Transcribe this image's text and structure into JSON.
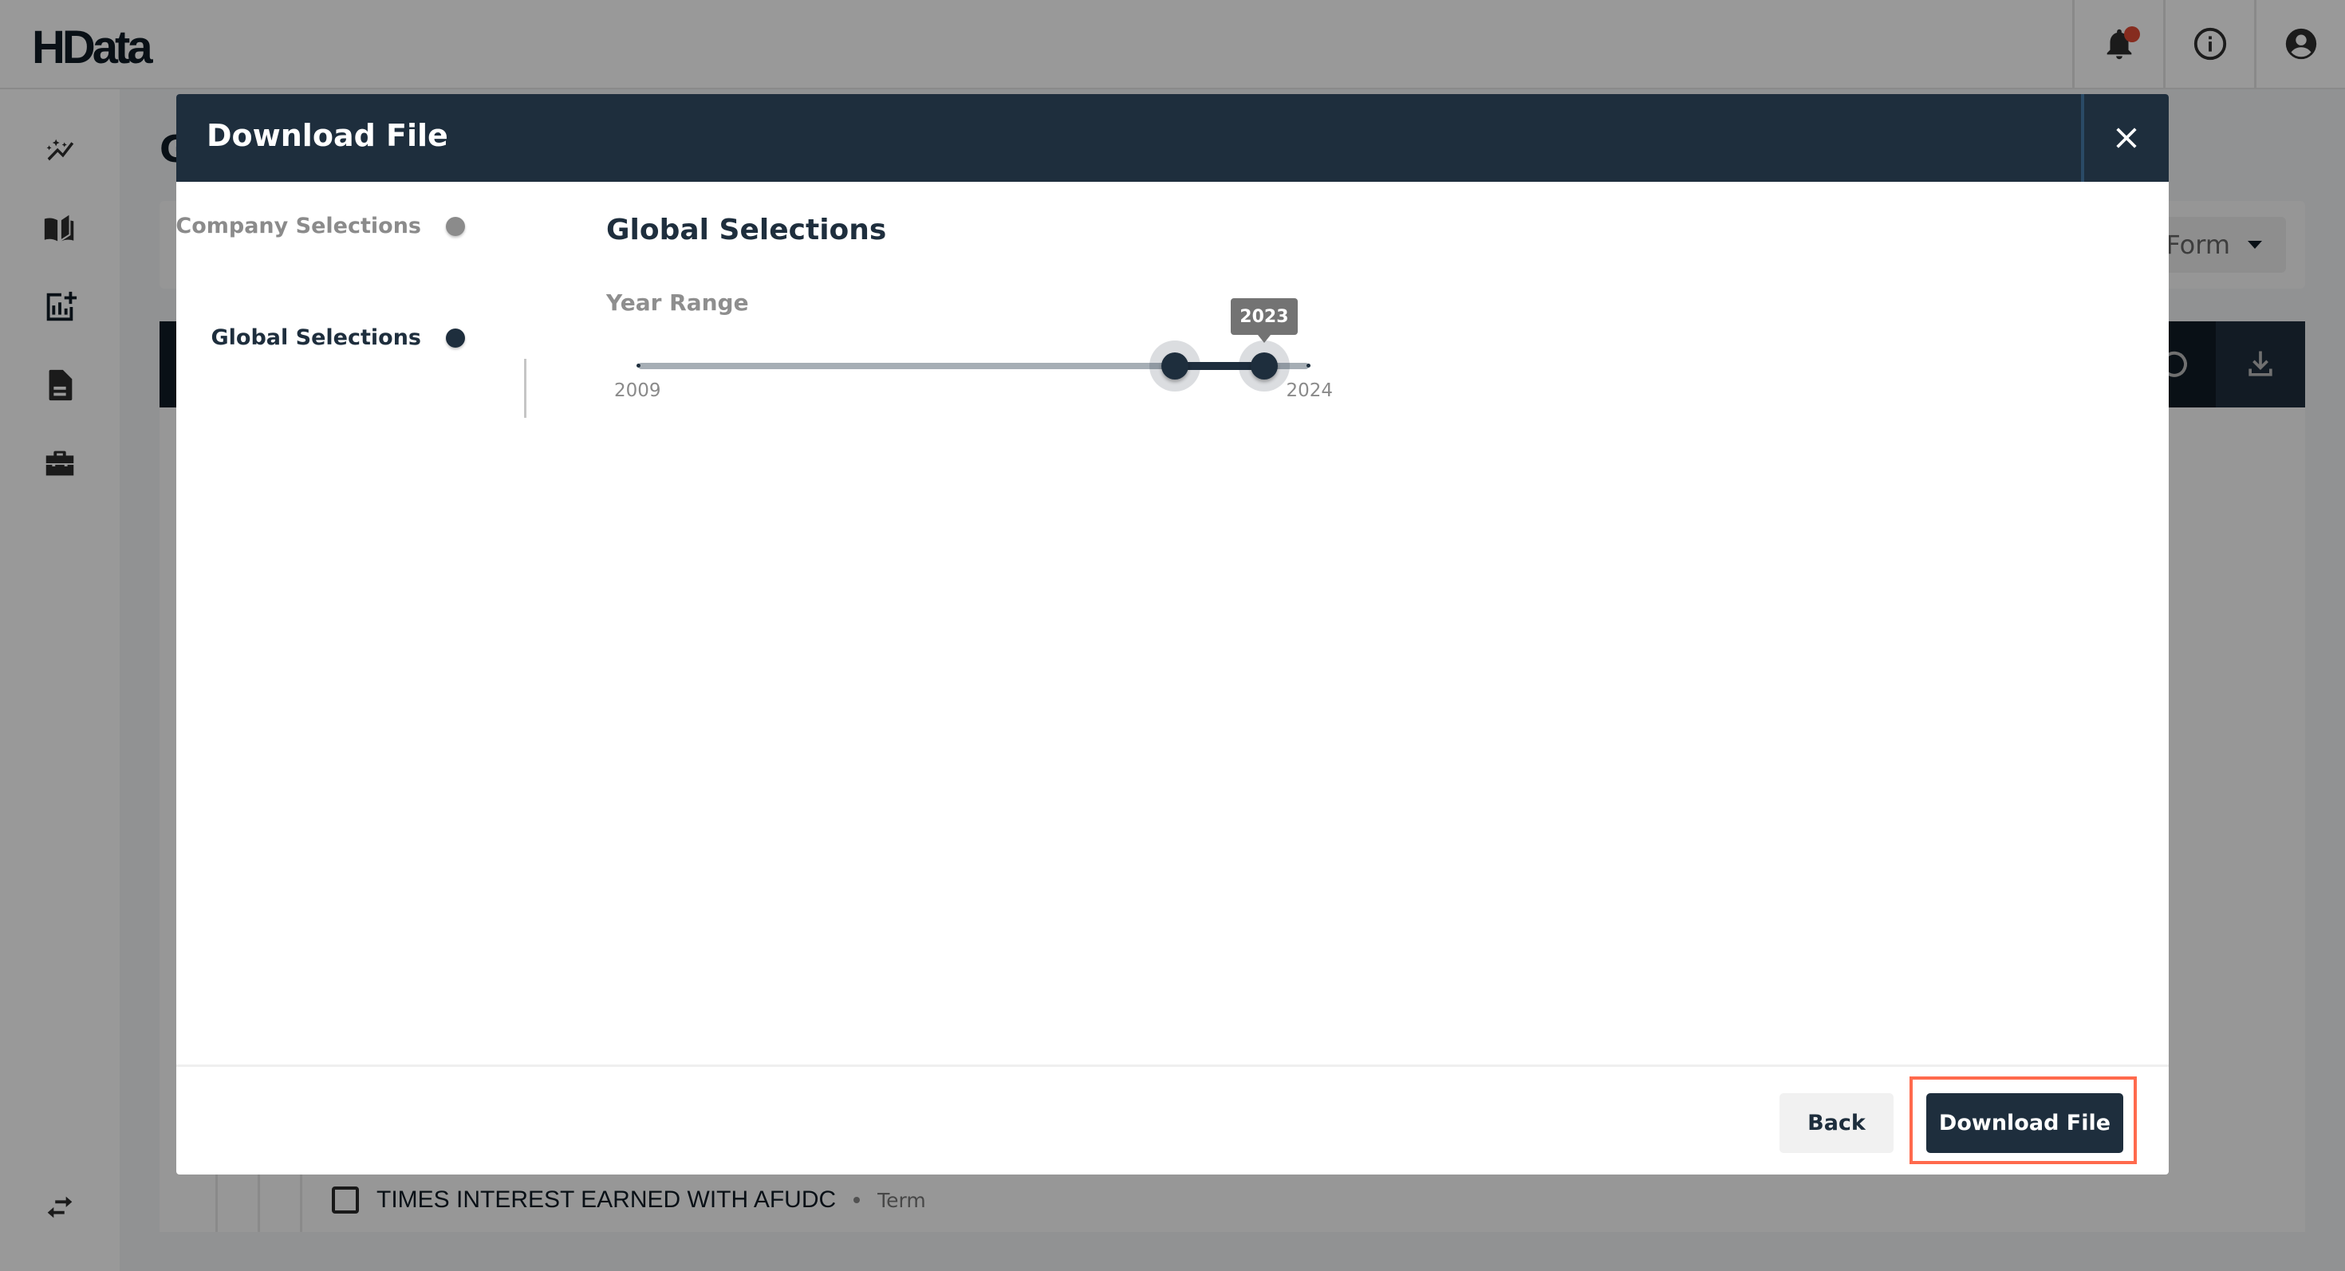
{
  "app": {
    "logo": "HData",
    "notification_badge_color": "#e04a35"
  },
  "header_icons": [
    "bell-icon",
    "info-icon",
    "account-icon"
  ],
  "sidebar": {
    "items": [
      {
        "icon": "insights-sparkle-icon"
      },
      {
        "icon": "open-book-icon"
      },
      {
        "icon": "add-chart-icon",
        "active": true
      },
      {
        "icon": "document-icon"
      },
      {
        "icon": "briefcase-icon"
      }
    ],
    "bottom_icon": "swap-arrows-icon"
  },
  "background": {
    "page_title_partial": "G",
    "select_value_partial": "Form",
    "row": {
      "label": "TIMES INTEREST EARNED WITH AFUDC",
      "type": "Term"
    }
  },
  "modal": {
    "title": "Download File",
    "steps": [
      {
        "label": "Company Selections",
        "state": "completed"
      },
      {
        "label": "Global Selections",
        "state": "active"
      }
    ],
    "section_title": "Global Selections",
    "year_range": {
      "label": "Year Range",
      "min": 2009,
      "max": 2024,
      "min_label": "2009",
      "max_label": "2024",
      "selected_start": 2021,
      "selected_end": 2023,
      "tooltip": "2023"
    },
    "footer": {
      "back_label": "Back",
      "download_label": "Download File"
    },
    "accent_color": "#1e2e3d",
    "highlight_color": "#ff6a4d"
  }
}
